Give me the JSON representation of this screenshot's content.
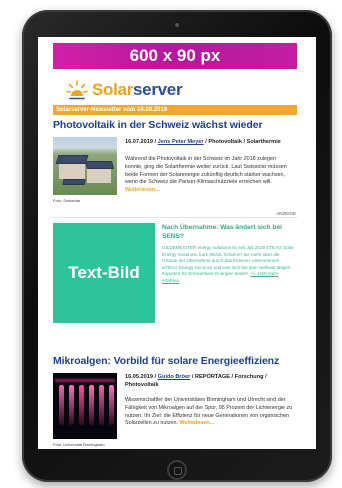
{
  "banner": {
    "label": "600 x 90 px"
  },
  "logo": {
    "word_solar": "Solar",
    "word_server": "server"
  },
  "newsletter_bar": {
    "label": "Solarserver-Newsletter vom 24.09.2019"
  },
  "article1": {
    "headline": "Photovoltaik in der Schweiz wächst wieder",
    "date": "16.07.2019 /",
    "author": "Jens Peter Meyer",
    "category": "/ Photovoltaik / Solarthermie",
    "body": "Während die Photovoltaik in der Schweiz im Jahr 2018 zulegen konnte, ging die Solarthermie weiter zurück. Laut Swissolar müssen beide Formen der Solarenergie zukünftig deutlich stärker wachsen, wenn die Schweiz die Pariser-Klimaschutzziele erreichen will.",
    "more": "Weiterlesen...",
    "photo_caption": "Foto: Swissolar"
  },
  "advert": {
    "anzeige": "ANZEIGE",
    "image_label": "Text-Bild",
    "title": "Nach Übernahme: Was ändert sich bei SENS?",
    "body": "GILDEMEISTER energy solutions ist seit Juli 2019 STEAG Solar Energy Solutions, kurz SENS. Erfahren Sie mehr über die Gründe der Übernahme durch das Essener Unternehmen STEAG Energy Services und was sich bei dem weltweit tätigen Experten für Erneuerbare Energien ändert.",
    "more": ">> Jetzt mehr erfahren"
  },
  "article2": {
    "headline": "Mikroalgen: Vorbild für solare Energieeffizienz",
    "date": "16.05.2019 /",
    "author": "Guido Bröer",
    "category": "/ REPORTAGE / Forschung / Photovoltaik",
    "body": "Wissenschaftler der Universitäten Birmingham und Utrecht sind der Fähigkeit von Mikroalgen auf der Spur, 95 Prozent der Lichtenergie zu nutzen. Ihr Ziel: die Effizienz für neue Generationen von organischen Solarzellen zu nutzen.",
    "more": "Weiterlesen...",
    "photo_caption": "Foto: Universität Birmingham"
  },
  "colors": {
    "banner": "#c21ea4",
    "brand_blue": "#1f3f90",
    "brand_orange": "#f3a632",
    "ad_green": "#2ec49a"
  },
  "icons": [
    "sun-icon",
    "camera-dot",
    "home-button"
  ]
}
